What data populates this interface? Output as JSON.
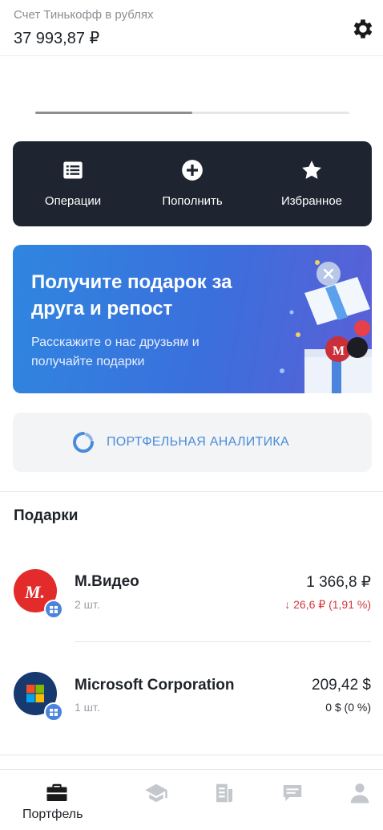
{
  "header": {
    "account_name": "Счет Тинькофф в рублях",
    "balance": "37 993,87 ₽",
    "settings_icon": "gear-icon"
  },
  "tabs_indicator": {
    "active_fraction": 0.5
  },
  "actions": [
    {
      "label": "Операции",
      "icon": "list-icon"
    },
    {
      "label": "Пополнить",
      "icon": "plus-circle-icon"
    },
    {
      "label": "Избранное",
      "icon": "star-icon"
    }
  ],
  "promo": {
    "title": "Получите подарок за друга и репост",
    "text": "Расскажите о нас друзьям и получайте подарки",
    "close_icon": "close-icon"
  },
  "analytics": {
    "label": "ПОРТФЕЛЬНАЯ АНАЛИТИКА",
    "icon": "spinner-icon"
  },
  "gifts": {
    "title": "Подарки",
    "items": [
      {
        "name": "М.Видео",
        "qty": "2 шт.",
        "price": "1 366,8 ₽",
        "change": "26,6 ₽ (1,91 %)",
        "change_direction": "down",
        "logo_letter": "М.",
        "logo_color": "#e32b2b"
      },
      {
        "name": "Microsoft Corporation",
        "qty": "1 шт.",
        "price": "209,42 $",
        "change": "0 $ (0 %)",
        "change_direction": "none",
        "logo_color": "#163a70"
      }
    ]
  },
  "bottom_nav": {
    "items": [
      {
        "label": "Портфель",
        "icon": "briefcase-icon",
        "active": true
      },
      {
        "label": "",
        "icon": "graduation-cap-icon",
        "active": false
      },
      {
        "label": "",
        "icon": "news-icon",
        "active": false
      },
      {
        "label": "",
        "icon": "chat-icon",
        "active": false
      },
      {
        "label": "",
        "icon": "profile-icon",
        "active": false
      }
    ]
  },
  "colors": {
    "accent_blue": "#4a8cdb",
    "negative_red": "#d0393e",
    "dark_panel": "#1e2430"
  }
}
